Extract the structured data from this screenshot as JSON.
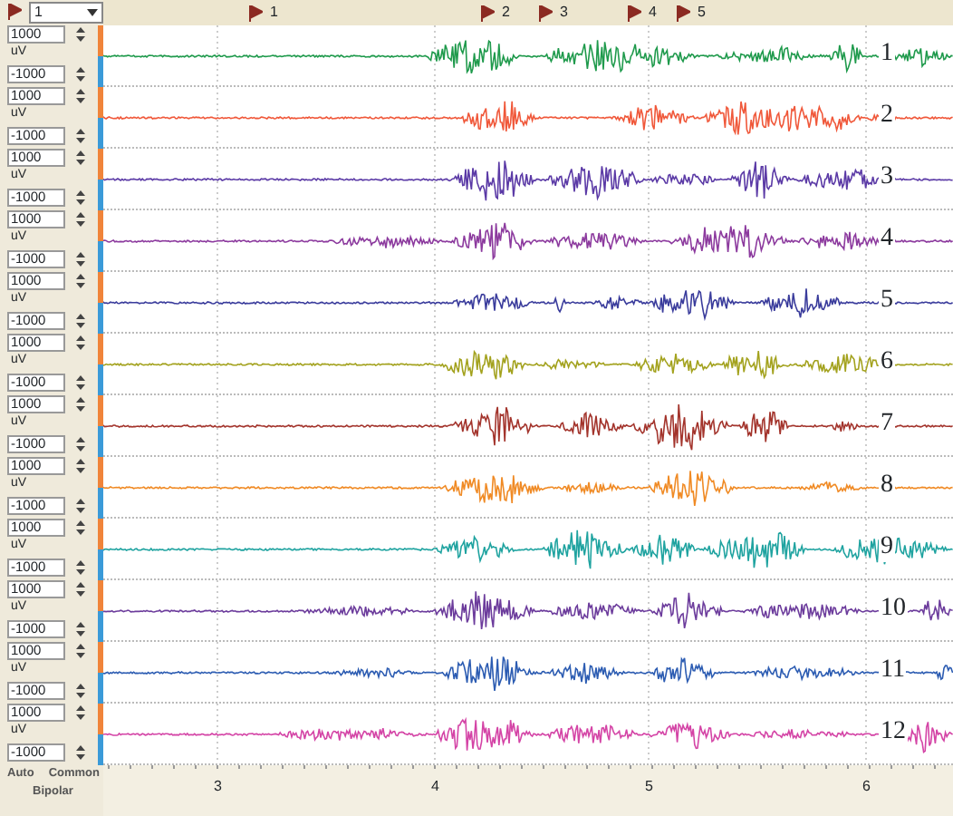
{
  "marker_select": {
    "value": "1"
  },
  "markers": [
    {
      "label": "1"
    },
    {
      "label": "2"
    },
    {
      "label": "3"
    },
    {
      "label": "4"
    },
    {
      "label": "5"
    }
  ],
  "channels": [
    {
      "label": "1",
      "color": "#1f9a4c",
      "max": "1000",
      "unit": "uV",
      "min": "-1000"
    },
    {
      "label": "2",
      "color": "#f0583a",
      "max": "1000",
      "unit": "uV",
      "min": "-1000"
    },
    {
      "label": "3",
      "color": "#5b3aa6",
      "max": "1000",
      "unit": "uV",
      "min": "-1000"
    },
    {
      "label": "4",
      "color": "#8c3a9e",
      "max": "1000",
      "unit": "uV",
      "min": "-1000"
    },
    {
      "label": "5",
      "color": "#3a3c9c",
      "max": "1000",
      "unit": "uV",
      "min": "-1000"
    },
    {
      "label": "6",
      "color": "#a3a21e",
      "max": "1000",
      "unit": "uV",
      "min": "-1000"
    },
    {
      "label": "7",
      "color": "#a3342c",
      "max": "1000",
      "unit": "uV",
      "min": "-1000"
    },
    {
      "label": "8",
      "color": "#f08a24",
      "max": "1000",
      "unit": "uV",
      "min": "-1000"
    },
    {
      "label": "9",
      "color": "#1fa3a0",
      "max": "1000",
      "unit": "uV",
      "min": "-1000"
    },
    {
      "label": "10",
      "color": "#6c3c9c",
      "max": "1000",
      "unit": "uV",
      "min": "-1000"
    },
    {
      "label": "11",
      "color": "#2c5cb2",
      "max": "1000",
      "unit": "uV",
      "min": "-1000"
    },
    {
      "label": "12",
      "color": "#d444a6",
      "max": "1000",
      "unit": "uV",
      "min": "-1000"
    }
  ],
  "footer": {
    "auto": "Auto",
    "common": "Common",
    "bipolar": "Bipolar"
  },
  "time_axis": {
    "ticks": [
      "3",
      "4",
      "5",
      "6"
    ]
  }
}
